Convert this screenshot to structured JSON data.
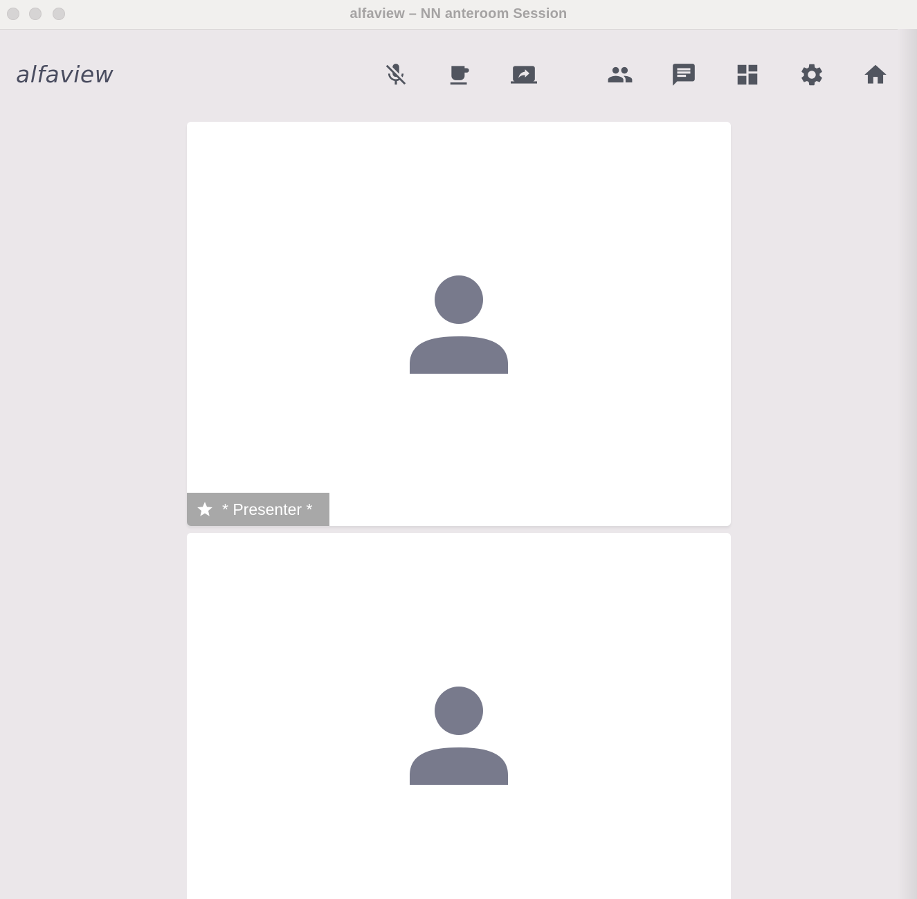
{
  "window": {
    "title": "alfaview – NN anteroom Session"
  },
  "app": {
    "logo": "alfaview"
  },
  "toolbar": {
    "items": [
      {
        "name": "mic-muted",
        "icon": "mic-off-icon"
      },
      {
        "name": "break",
        "icon": "coffee-icon"
      },
      {
        "name": "screen-share",
        "icon": "screen-share-icon"
      },
      {
        "name": "participants",
        "icon": "people-icon"
      },
      {
        "name": "chat",
        "icon": "chat-icon"
      },
      {
        "name": "layout",
        "icon": "grid-icon"
      },
      {
        "name": "settings",
        "icon": "gear-icon"
      },
      {
        "name": "home",
        "icon": "home-icon"
      }
    ]
  },
  "tiles": [
    {
      "avatar_icon": "person-icon",
      "badge": {
        "icon": "star-icon",
        "label": "* Presenter *"
      }
    },
    {
      "avatar_icon": "person-icon"
    }
  ],
  "colors": {
    "background": "#ebe7ea",
    "icon": "#51555f",
    "avatar": "#787a8c",
    "badge": "#a8a8a8"
  }
}
